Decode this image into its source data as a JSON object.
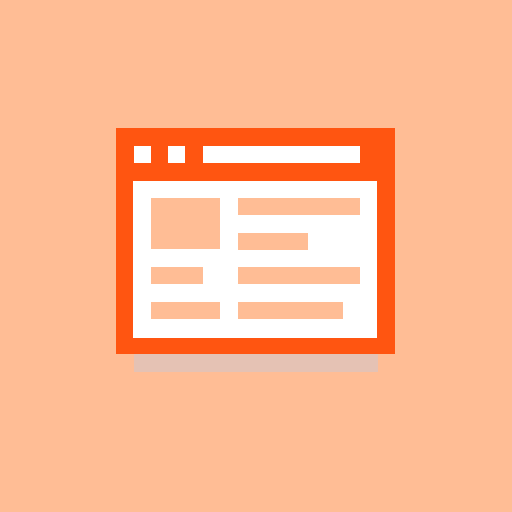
{
  "icon": {
    "name": "browser-window-icon",
    "colors": {
      "background": "#FFBD95",
      "frame": "#FF5511",
      "content": "#FFFFFF",
      "placeholder": "#FFBD95",
      "shadow": "#E5C2B4"
    }
  }
}
